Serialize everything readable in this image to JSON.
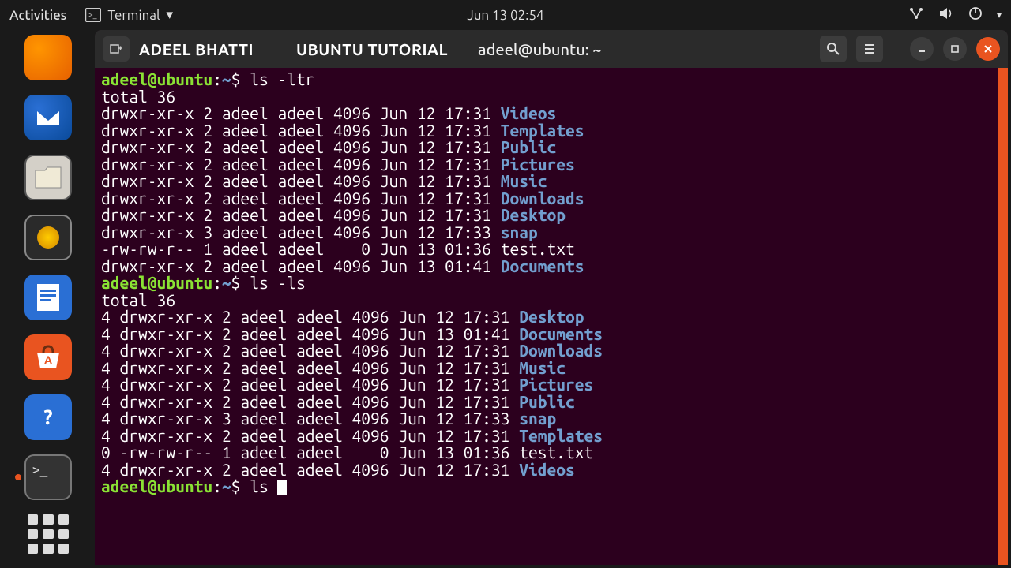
{
  "topbar": {
    "activities": "Activities",
    "app_label": "Terminal",
    "dropdown": "▾",
    "datetime": "Jun 13  02:54"
  },
  "titlebar": {
    "text1": "ADEEL BHATTI",
    "text2": "UBUNTU TUTORIAL",
    "window_title": "adeel@ubuntu: ~"
  },
  "prompt": {
    "user_host": "adeel@ubuntu",
    "colon": ":",
    "path": "~",
    "dollar": "$"
  },
  "session": {
    "cmd1": "ls -ltr",
    "total1": "total 36",
    "ls_ltr": [
      {
        "meta": "drwxr-xr-x 2 adeel adeel 4096 Jun 12 17:31 ",
        "name": "Videos",
        "dir": true
      },
      {
        "meta": "drwxr-xr-x 2 adeel adeel 4096 Jun 12 17:31 ",
        "name": "Templates",
        "dir": true
      },
      {
        "meta": "drwxr-xr-x 2 adeel adeel 4096 Jun 12 17:31 ",
        "name": "Public",
        "dir": true
      },
      {
        "meta": "drwxr-xr-x 2 adeel adeel 4096 Jun 12 17:31 ",
        "name": "Pictures",
        "dir": true
      },
      {
        "meta": "drwxr-xr-x 2 adeel adeel 4096 Jun 12 17:31 ",
        "name": "Music",
        "dir": true
      },
      {
        "meta": "drwxr-xr-x 2 adeel adeel 4096 Jun 12 17:31 ",
        "name": "Downloads",
        "dir": true
      },
      {
        "meta": "drwxr-xr-x 2 adeel adeel 4096 Jun 12 17:31 ",
        "name": "Desktop",
        "dir": true
      },
      {
        "meta": "drwxr-xr-x 3 adeel adeel 4096 Jun 12 17:33 ",
        "name": "snap",
        "dir": true
      },
      {
        "meta": "-rw-rw-r-- 1 adeel adeel    0 Jun 13 01:36 ",
        "name": "test.txt",
        "dir": false
      },
      {
        "meta": "drwxr-xr-x 2 adeel adeel 4096 Jun 13 01:41 ",
        "name": "Documents",
        "dir": true
      }
    ],
    "cmd2": "ls -ls",
    "total2": "total 36",
    "ls_ls": [
      {
        "meta": "4 drwxr-xr-x 2 adeel adeel 4096 Jun 12 17:31 ",
        "name": "Desktop",
        "dir": true
      },
      {
        "meta": "4 drwxr-xr-x 2 adeel adeel 4096 Jun 13 01:41 ",
        "name": "Documents",
        "dir": true
      },
      {
        "meta": "4 drwxr-xr-x 2 adeel adeel 4096 Jun 12 17:31 ",
        "name": "Downloads",
        "dir": true
      },
      {
        "meta": "4 drwxr-xr-x 2 adeel adeel 4096 Jun 12 17:31 ",
        "name": "Music",
        "dir": true
      },
      {
        "meta": "4 drwxr-xr-x 2 adeel adeel 4096 Jun 12 17:31 ",
        "name": "Pictures",
        "dir": true
      },
      {
        "meta": "4 drwxr-xr-x 2 adeel adeel 4096 Jun 12 17:31 ",
        "name": "Public",
        "dir": true
      },
      {
        "meta": "4 drwxr-xr-x 3 adeel adeel 4096 Jun 12 17:33 ",
        "name": "snap",
        "dir": true
      },
      {
        "meta": "4 drwxr-xr-x 2 adeel adeel 4096 Jun 12 17:31 ",
        "name": "Templates",
        "dir": true
      },
      {
        "meta": "0 -rw-rw-r-- 1 adeel adeel    0 Jun 13 01:36 ",
        "name": "test.txt",
        "dir": false
      },
      {
        "meta": "4 drwxr-xr-x 2 adeel adeel 4096 Jun 12 17:31 ",
        "name": "Videos",
        "dir": true
      }
    ],
    "cmd3": "ls "
  }
}
